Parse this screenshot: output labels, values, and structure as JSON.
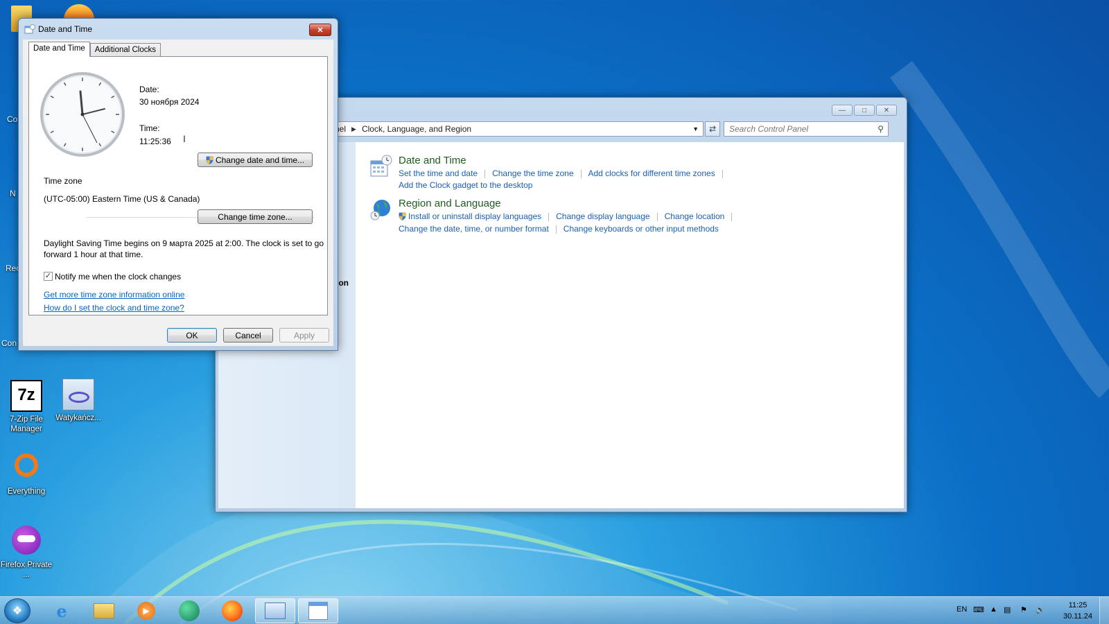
{
  "desktop": {
    "icons": [
      {
        "label": "7-Zip File Manager"
      },
      {
        "label": "Watykańcz..."
      },
      {
        "label": "Everything"
      },
      {
        "label": "Firefox Private ..."
      }
    ],
    "partial_labels": [
      "Co",
      "N",
      "Rec",
      "Con"
    ]
  },
  "control_panel": {
    "breadcrumb": {
      "prefix": "nel",
      "current": "Clock, Language, and Region"
    },
    "search_placeholder": "Search Control Panel",
    "left_fragment": "ion",
    "sections": [
      {
        "heading": "Date and Time",
        "icon": "calendar-clock-icon",
        "links_row1": [
          "Set the time and date",
          "Change the time zone",
          "Add clocks for different time zones"
        ],
        "links_row2": [
          "Add the Clock gadget to the desktop"
        ]
      },
      {
        "heading": "Region and Language",
        "icon": "globe-icon",
        "links_row1": [
          "Install or uninstall display languages",
          "Change display language",
          "Change location"
        ],
        "links_row2": [
          "Change the date, time, or number format",
          "Change keyboards or other input methods"
        ]
      }
    ]
  },
  "dialog": {
    "title": "Date and Time",
    "tabs": [
      "Date and Time",
      "Additional Clocks"
    ],
    "date_label": "Date:",
    "date_value": "30 ноября 2024",
    "time_label": "Time:",
    "time_value": "11:25:36",
    "change_datetime_button": "Change date and time...",
    "timezone_heading": "Time zone",
    "timezone_value": "(UTC-05:00) Eastern Time (US & Canada)",
    "change_timezone_button": "Change time zone...",
    "dst_text_line1": "Daylight Saving Time begins on 9 марта 2025 at 2:00. The clock is set to go",
    "dst_text_line2": "forward 1 hour at that time.",
    "notify_checkbox_label": "Notify me when the clock changes",
    "notify_checked": true,
    "link_more_info": "Get more time zone information online",
    "link_how_to": "How do I set the clock and time zone?",
    "ok_button": "OK",
    "cancel_button": "Cancel",
    "apply_button": "Apply"
  },
  "taskbar": {
    "language": "EN",
    "clock_time": "11:25",
    "clock_date": "30.11.24"
  }
}
